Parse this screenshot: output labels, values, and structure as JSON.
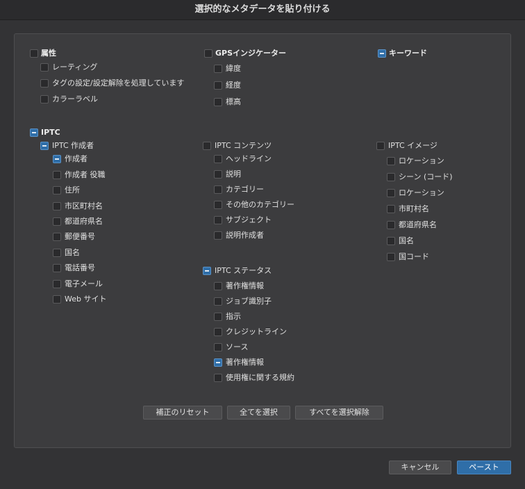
{
  "title": "選択的なメタデータを貼り付ける",
  "col1": {
    "attr": {
      "label": "属性",
      "checked": false
    },
    "attr_items": [
      {
        "label": "レーティング",
        "checked": false
      },
      {
        "label": "タグの設定/設定解除を処理しています",
        "checked": false
      },
      {
        "label": "カラーラベル",
        "checked": false
      }
    ],
    "iptc": {
      "label": "IPTC",
      "state": "mixed"
    },
    "iptc_creator": {
      "label": "IPTC 作成者",
      "state": "mixed"
    },
    "creator_items": [
      {
        "label": "作成者",
        "checked": true
      },
      {
        "label": "作成者 役職",
        "checked": false
      },
      {
        "label": "住所",
        "checked": false
      },
      {
        "label": "市区町村名",
        "checked": false
      },
      {
        "label": "都道府県名",
        "checked": false
      },
      {
        "label": "郵便番号",
        "checked": false
      },
      {
        "label": "国名",
        "checked": false
      },
      {
        "label": "電話番号",
        "checked": false
      },
      {
        "label": "電子メール",
        "checked": false
      },
      {
        "label": "Web サイト",
        "checked": false
      }
    ]
  },
  "col2": {
    "gps": {
      "label": "GPSインジケーター",
      "checked": false
    },
    "gps_items": [
      {
        "label": "緯度",
        "checked": false
      },
      {
        "label": "経度",
        "checked": false
      },
      {
        "label": "標高",
        "checked": false
      }
    ],
    "contents": {
      "label": "IPTC コンテンツ",
      "checked": false
    },
    "contents_items": [
      {
        "label": "ヘッドライン",
        "checked": false
      },
      {
        "label": "説明",
        "checked": false
      },
      {
        "label": "カテゴリー",
        "checked": false
      },
      {
        "label": "その他のカテゴリー",
        "checked": false
      },
      {
        "label": "サブジェクト",
        "checked": false
      },
      {
        "label": "説明作成者",
        "checked": false
      }
    ],
    "status": {
      "label": "IPTC ステータス",
      "state": "mixed"
    },
    "status_items": [
      {
        "label": "著作権情報",
        "checked": false
      },
      {
        "label": "ジョブ識別子",
        "checked": false
      },
      {
        "label": "指示",
        "checked": false
      },
      {
        "label": "クレジットライン",
        "checked": false
      },
      {
        "label": "ソース",
        "checked": false
      },
      {
        "label": "著作権情報",
        "checked": true
      },
      {
        "label": "使用権に関する規約",
        "checked": false
      }
    ]
  },
  "col3": {
    "keyword": {
      "label": "キーワード",
      "checked": true
    },
    "image": {
      "label": "IPTC イメージ",
      "checked": false
    },
    "image_items": [
      {
        "label": "ロケーション",
        "checked": false
      },
      {
        "label": "シーン (コード)",
        "checked": false
      },
      {
        "label": "ロケーション",
        "checked": false
      },
      {
        "label": "市町村名",
        "checked": false
      },
      {
        "label": "都道府県名",
        "checked": false
      },
      {
        "label": "国名",
        "checked": false
      },
      {
        "label": "国コード",
        "checked": false
      }
    ]
  },
  "buttons": {
    "reset": "補正のリセット",
    "select_all": "全てを選択",
    "deselect_all": "すべてを選択解除",
    "cancel": "キャンセル",
    "paste": "ペースト"
  }
}
